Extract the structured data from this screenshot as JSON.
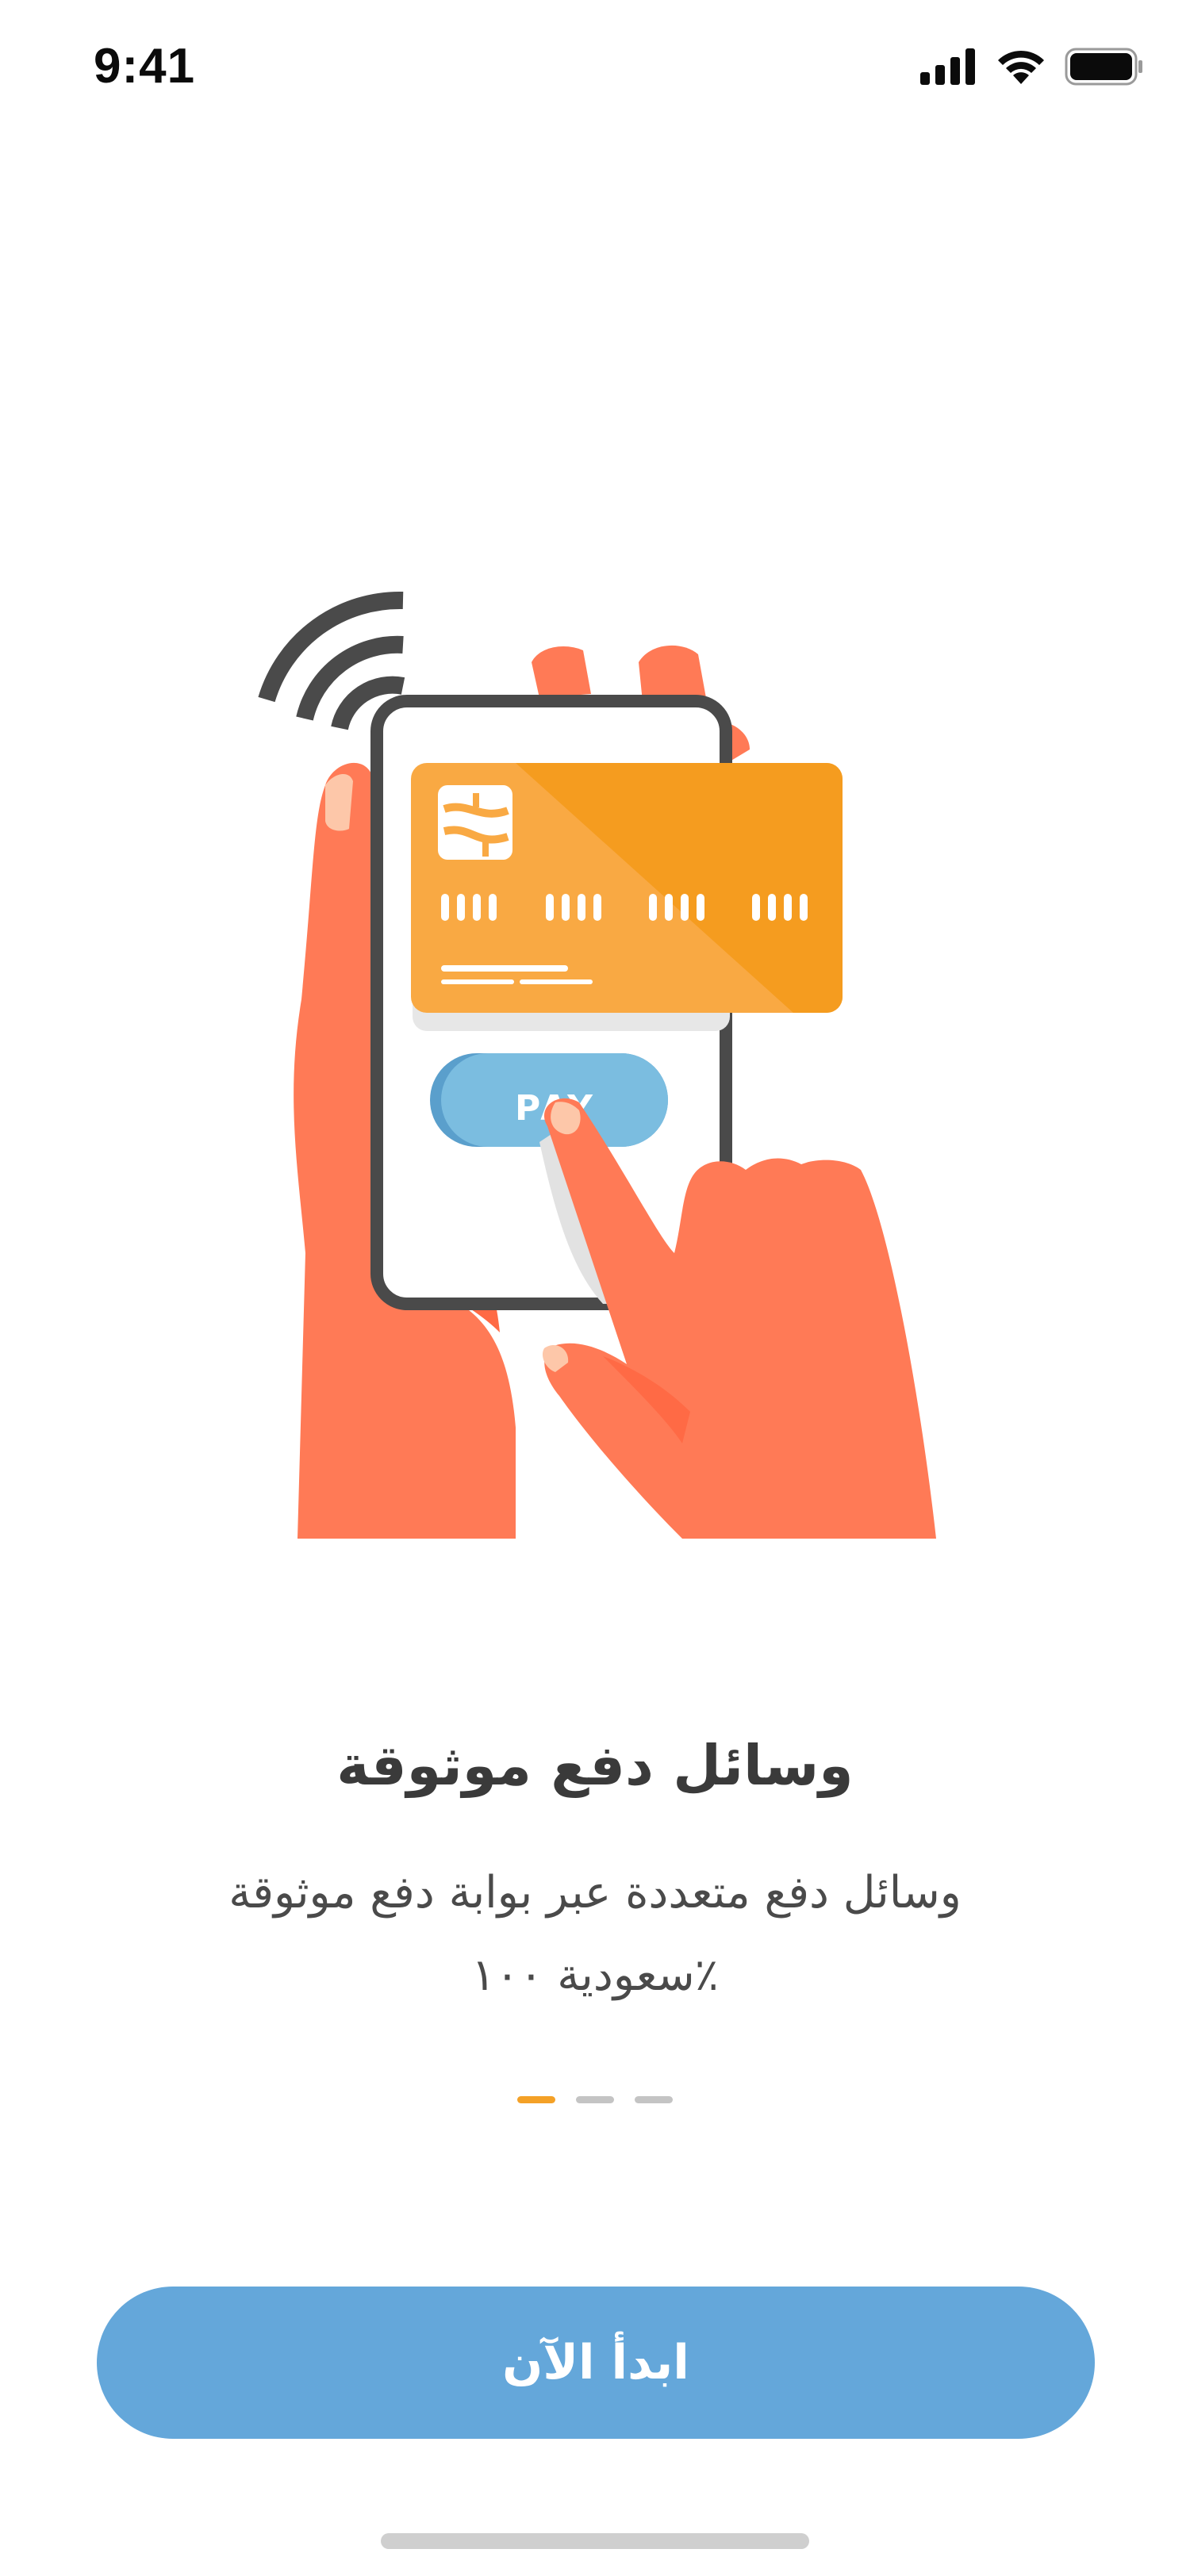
{
  "status_bar": {
    "time": "9:41",
    "icons": [
      "cellular-signal-icon",
      "wifi-icon",
      "battery-icon"
    ]
  },
  "illustration": {
    "pay_label": "PAY",
    "icons": [
      "contactless-waves-icon",
      "card-chip-icon"
    ]
  },
  "onboarding": {
    "title": "وسائل دفع موثوقة",
    "subtitle": "وسائل دفع متعددة عبر بوابة دفع موثوقة ٪سعودية ١٠٠",
    "pages": 3,
    "active_page": 1
  },
  "cta": {
    "label": "ابدأ الآن"
  },
  "colors": {
    "accent_orange": "#f4a127",
    "button_blue": "#64a7da",
    "hand_coral": "#ff7a56",
    "pay_button": "#7bbde0",
    "text_dark": "#3a3a3a"
  }
}
